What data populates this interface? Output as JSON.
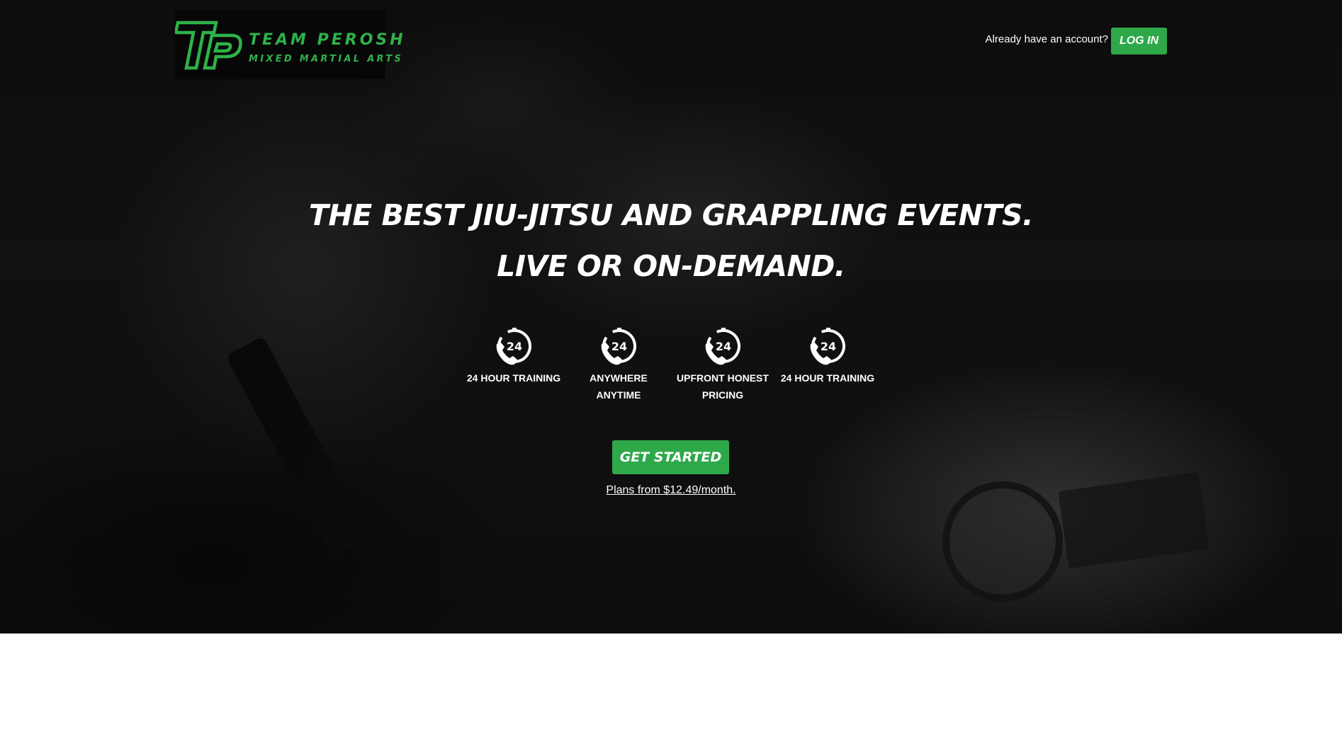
{
  "brand": {
    "name": "TEAM PEROSH",
    "tagline": "MIXED MARTIAL ARTS",
    "accent_color": "#2fb24a"
  },
  "header": {
    "account_prompt": "Already have an account?",
    "login_label": "LOG IN"
  },
  "hero": {
    "headline_line1": "THE BEST JIU-JITSU AND GRAPPLING EVENTS.",
    "headline_line2": "LIVE OR ON-DEMAND.",
    "features": [
      {
        "icon": "24-hour-phone-icon",
        "label": "24 HOUR TRAINING"
      },
      {
        "icon": "24-hour-phone-icon",
        "label": "ANYWHERE ANYTIME"
      },
      {
        "icon": "24-hour-phone-icon",
        "label": "UPFRONT HONEST PRICING"
      },
      {
        "icon": "24-hour-phone-icon",
        "label": "24 HOUR TRAINING"
      }
    ],
    "cta_label": "GET STARTED",
    "plans_link": "Plans from $12.49/month.",
    "button_color": "#2fa84a"
  }
}
